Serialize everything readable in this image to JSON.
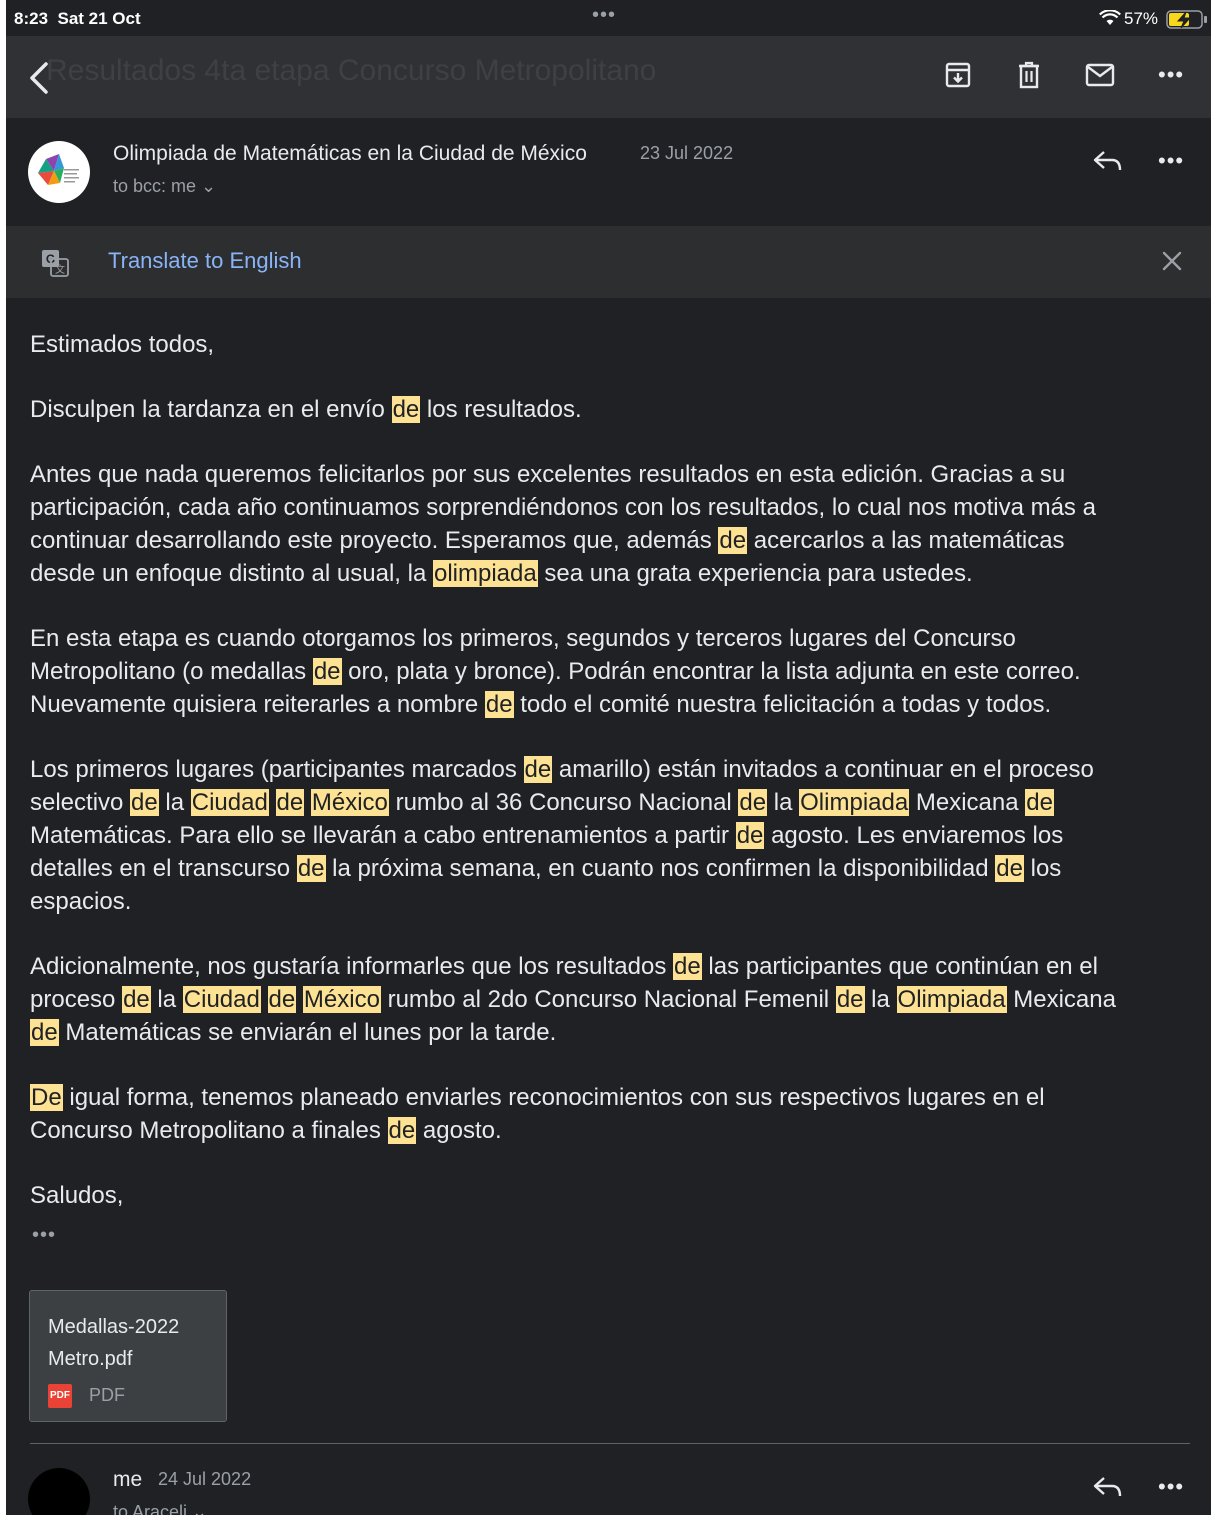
{
  "status_bar": {
    "time": "8:23",
    "date": "Sat 21 Oct",
    "center_dots": "•••",
    "battery_percent": "57%",
    "icons": [
      "wifi-icon",
      "battery-charging-icon"
    ]
  },
  "toolbar": {
    "subject": "Resultados 4ta etapa Concurso Metropolitano",
    "icons": [
      "back-icon",
      "archive-icon",
      "trash-icon",
      "mark-unread-icon",
      "more-icon"
    ],
    "more_label": "•••"
  },
  "message": {
    "sender": "Olimpiada de Matemáticas en la Ciudad de México",
    "date": "23 Jul 2022",
    "recipients": "to bcc: me ⌄",
    "more_label": "•••",
    "icons": [
      "reply-icon",
      "more-icon"
    ]
  },
  "translate_bar": {
    "link_label": "Translate to English",
    "icons": [
      "translate-icon",
      "close-icon"
    ]
  },
  "body": {
    "lines": [
      [
        {
          "t": "Estimados todos,"
        }
      ],
      [
        {
          "t": "Disculpen la tardanza en el envío "
        },
        {
          "t": "de",
          "h": true
        },
        {
          "t": " los resultados."
        }
      ],
      [
        {
          "t": "Antes que nada queremos felicitarlos por sus excelentes resultados en esta edición. Gracias a su"
        }
      ],
      [
        {
          "t": "participación, cada año continuamos sorprendiéndonos con los resultados, lo cual nos motiva más a"
        }
      ],
      [
        {
          "t": "continuar desarrollando este proyecto.  Esperamos que, además "
        },
        {
          "t": "de",
          "h": true
        },
        {
          "t": " acercarlos a las matemáticas"
        }
      ],
      [
        {
          "t": "desde un enfoque distinto al usual, la "
        },
        {
          "t": "olimpiada",
          "h": true
        },
        {
          "t": " sea una grata experiencia para ustedes."
        }
      ],
      [
        {
          "t": "En esta etapa es cuando otorgamos los primeros, segundos y terceros lugares del Concurso"
        }
      ],
      [
        {
          "t": "Metropolitano (o medallas "
        },
        {
          "t": "de",
          "h": true
        },
        {
          "t": " oro, plata y bronce). Podrán encontrar la lista adjunta en este correo."
        }
      ],
      [
        {
          "t": "Nuevamente quisiera reiterarles a nombre "
        },
        {
          "t": "de",
          "h": true
        },
        {
          "t": " todo el comité nuestra felicitación a todas y todos."
        }
      ],
      [
        {
          "t": "Los primeros lugares (participantes marcados "
        },
        {
          "t": "de",
          "h": true
        },
        {
          "t": " amarillo) están invitados a continuar en el proceso"
        }
      ],
      [
        {
          "t": "selectivo "
        },
        {
          "t": "de",
          "h": true
        },
        {
          "t": " la "
        },
        {
          "t": "Ciudad",
          "h": true
        },
        {
          "t": " "
        },
        {
          "t": "de",
          "h": true
        },
        {
          "t": " "
        },
        {
          "t": "México",
          "h": true
        },
        {
          "t": " rumbo al 36 Concurso Nacional "
        },
        {
          "t": "de",
          "h": true
        },
        {
          "t": " la "
        },
        {
          "t": "Olimpiada",
          "h": true
        },
        {
          "t": " Mexicana "
        },
        {
          "t": "de",
          "h": true
        }
      ],
      [
        {
          "t": "Matemáticas. Para ello se llevarán a cabo entrenamientos a partir "
        },
        {
          "t": "de",
          "h": true
        },
        {
          "t": " agosto. Les enviaremos los"
        }
      ],
      [
        {
          "t": "detalles en el transcurso "
        },
        {
          "t": "de",
          "h": true
        },
        {
          "t": " la próxima semana, en cuanto nos confirmen la disponibilidad "
        },
        {
          "t": "de",
          "h": true
        },
        {
          "t": " los"
        }
      ],
      [
        {
          "t": "espacios."
        }
      ],
      [
        {
          "t": "Adicionalmente, nos gustaría informarles que los resultados "
        },
        {
          "t": "de",
          "h": true
        },
        {
          "t": " las participantes que continúan en el"
        }
      ],
      [
        {
          "t": "proceso "
        },
        {
          "t": "de",
          "h": true
        },
        {
          "t": " la "
        },
        {
          "t": "Ciudad",
          "h": true
        },
        {
          "t": " "
        },
        {
          "t": "de",
          "h": true
        },
        {
          "t": " "
        },
        {
          "t": "México",
          "h": true
        },
        {
          "t": " rumbo al 2do Concurso Nacional Femenil "
        },
        {
          "t": "de",
          "h": true
        },
        {
          "t": " la "
        },
        {
          "t": "Olimpiada",
          "h": true
        },
        {
          "t": " Mexicana"
        }
      ],
      [
        {
          "t": "de",
          "h": true
        },
        {
          "t": " Matemáticas se enviarán el lunes por la tarde."
        }
      ],
      [
        {
          "t": "De",
          "h": true
        },
        {
          "t": " igual forma, tenemos planeado enviarles reconocimientos con sus respectivos lugares en el"
        }
      ],
      [
        {
          "t": "Concurso Metropolitano a finales "
        },
        {
          "t": "de",
          "h": true
        },
        {
          "t": " agosto."
        }
      ],
      [
        {
          "t": "Saludos,"
        }
      ]
    ],
    "paragraphs": [
      [
        0
      ],
      [
        1
      ],
      [
        2,
        3,
        4,
        5
      ],
      [
        6,
        7,
        8
      ],
      [
        9,
        10,
        11,
        12,
        13
      ],
      [
        14,
        15,
        16
      ],
      [
        17,
        18
      ],
      [
        19
      ]
    ],
    "trimmed_label": "•••",
    "highlight_color": "#fde293"
  },
  "attachment": {
    "name_line1": "Medallas-2022",
    "name_line2": "Metro.pdf",
    "badge": "PDF",
    "type": "PDF"
  },
  "message2": {
    "sender": "me",
    "date": "24 Jul 2022",
    "recipients": "to Araceli ⌄",
    "more_label": "•••"
  }
}
